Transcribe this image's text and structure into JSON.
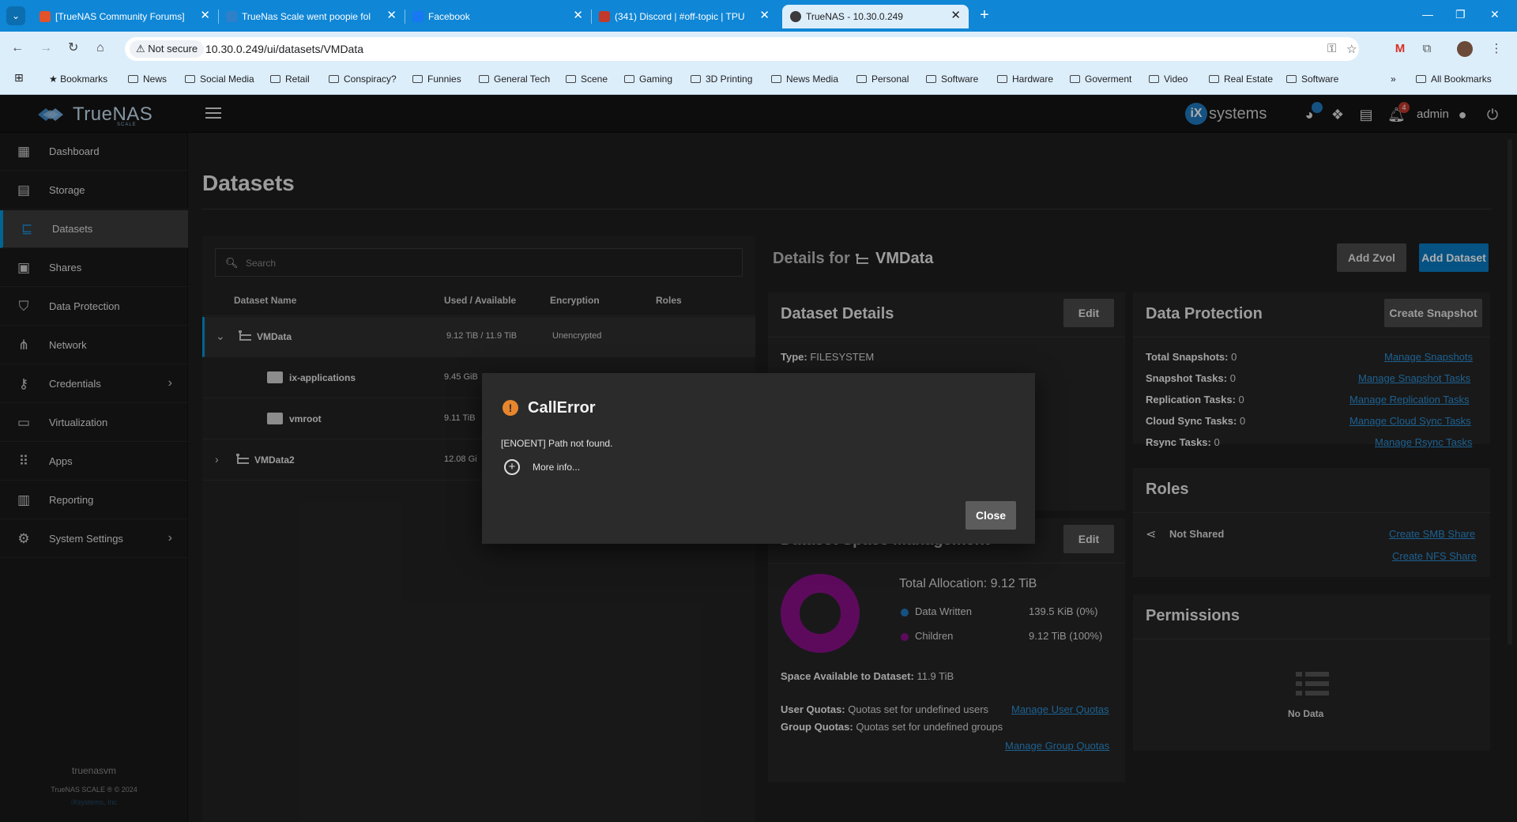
{
  "browser": {
    "tabs": [
      {
        "title": "[TrueNAS Community Forums]",
        "favicon_color": "#e2522b"
      },
      {
        "title": "TrueNas Scale went poopie fol",
        "favicon_color": "#2f80c8"
      },
      {
        "title": "Facebook",
        "favicon_color": "#1877f2"
      },
      {
        "title": "(341) Discord | #off-topic | TPU",
        "favicon_color": "#c0392b"
      },
      {
        "title": "TrueNAS - 10.30.0.249",
        "favicon_color": "#3b3b3b"
      }
    ],
    "address": {
      "security_label": "Not secure",
      "url": "10.30.0.249/ui/datasets/VMData"
    },
    "bookmarks": [
      "Bookmarks",
      "News",
      "Social Media",
      "Retail",
      "Conspiracy?",
      "Funnies",
      "General Tech",
      "Scene",
      "Gaming",
      "3D Printing",
      "News Media",
      "Personal",
      "Software",
      "Hardware",
      "Goverment",
      "Video",
      "Real Estate",
      "Software"
    ],
    "overflow_label": "»",
    "all_bookmarks_label": "All Bookmarks"
  },
  "header": {
    "logo_text": "TrueNAS",
    "logo_sub": "SCALE",
    "brand_ix": "iX",
    "brand_systems": "systems",
    "notification_count": "4",
    "user": "admin"
  },
  "sidebar": {
    "items": [
      {
        "label": "Dashboard",
        "icon": "dashboard-icon"
      },
      {
        "label": "Storage",
        "icon": "storage-icon"
      },
      {
        "label": "Datasets",
        "icon": "datasets-icon"
      },
      {
        "label": "Shares",
        "icon": "shares-icon"
      },
      {
        "label": "Data Protection",
        "icon": "shield-icon"
      },
      {
        "label": "Network",
        "icon": "network-icon"
      },
      {
        "label": "Credentials",
        "icon": "key-icon"
      },
      {
        "label": "Virtualization",
        "icon": "laptop-icon"
      },
      {
        "label": "Apps",
        "icon": "apps-grid-icon"
      },
      {
        "label": "Reporting",
        "icon": "chart-icon"
      },
      {
        "label": "System Settings",
        "icon": "gear-icon"
      }
    ],
    "hostname": "truenasvm",
    "copyright": "TrueNAS SCALE ® © 2024",
    "company": "iXsystems, Inc"
  },
  "main": {
    "title": "Datasets",
    "search_placeholder": "Search",
    "columns": [
      "Dataset Name",
      "Used / Available",
      "Encryption",
      "Roles"
    ],
    "rows": [
      {
        "name": "VMData",
        "used": "9.12 TiB / 11.9 TiB",
        "encryption": "Unencrypted"
      },
      {
        "name": "ix-applications",
        "used": "9.45 GiB",
        "encryption": ""
      },
      {
        "name": "vmroot",
        "used": "9.11 TiB",
        "encryption": ""
      },
      {
        "name": "VMData2",
        "used": "12.08 Gi",
        "encryption": ""
      }
    ],
    "details_for_label": "Details for",
    "details_name": "VMData",
    "add_zvol": "Add Zvol",
    "add_dataset": "Add Dataset"
  },
  "dataset_details": {
    "title": "Dataset Details",
    "edit": "Edit",
    "type_label": "Type:",
    "type_value": "FILESYSTEM"
  },
  "space": {
    "title": "Dataset Space Management",
    "edit": "Edit",
    "total_label": "Total Allocation:",
    "total_value": "9.12 TiB",
    "written_label": "Data Written",
    "written_value": "139.5 KiB (0%)",
    "children_label": "Children",
    "children_value": "9.12 TiB (100%)",
    "written_fraction": 0.0001,
    "children_fraction": 0.9999,
    "written_color": "#1f7ac0",
    "children_color": "#8a0f8a",
    "available_label": "Space Available to Dataset:",
    "available_value": "11.9 TiB",
    "user_quotas_label": "User Quotas:",
    "user_quotas_value": "Quotas set for undefined users",
    "user_quotas_link": "Manage User Quotas",
    "group_quotas_label": "Group Quotas:",
    "group_quotas_value": "Quotas set for undefined groups",
    "group_quotas_link": "Manage Group Quotas"
  },
  "protection": {
    "title": "Data Protection",
    "create_snapshot": "Create Snapshot",
    "items": [
      {
        "label": "Total Snapshots:",
        "value": "0",
        "link": "Manage Snapshots"
      },
      {
        "label": "Snapshot Tasks:",
        "value": "0",
        "link": "Manage Snapshot Tasks"
      },
      {
        "label": "Replication Tasks:",
        "value": "0",
        "link": "Manage Replication Tasks"
      },
      {
        "label": "Cloud Sync Tasks:",
        "value": "0",
        "link": "Manage Cloud Sync Tasks"
      },
      {
        "label": "Rsync Tasks:",
        "value": "0",
        "link": "Manage Rsync Tasks"
      }
    ]
  },
  "roles": {
    "title": "Roles",
    "status": "Not Shared",
    "smb_link": "Create SMB Share",
    "nfs_link": "Create NFS Share"
  },
  "permissions": {
    "title": "Permissions",
    "empty": "No Data"
  },
  "dialog": {
    "title": "CallError",
    "message": "[ENOENT] Path not found.",
    "more_info": "More info...",
    "close": "Close"
  }
}
